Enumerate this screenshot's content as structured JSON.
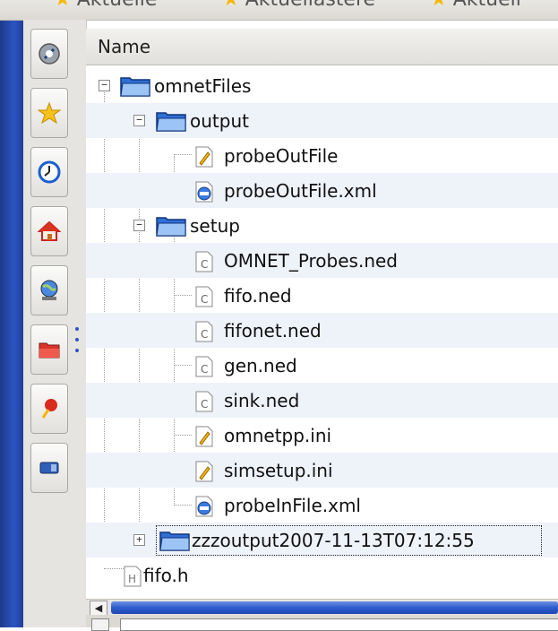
{
  "topbar": {
    "crumbs": [
      "Aktuelle",
      "Aktuellastere",
      "Aktuell"
    ]
  },
  "sidebar": {
    "items": [
      {
        "icon": "network-icon"
      },
      {
        "icon": "star-icon"
      },
      {
        "icon": "history-clock-icon"
      },
      {
        "icon": "home-icon"
      },
      {
        "icon": "network-globe-icon"
      },
      {
        "icon": "folder-icon"
      },
      {
        "icon": "pin-icon"
      },
      {
        "icon": "device-icon"
      }
    ]
  },
  "tree": {
    "column_header": "Name",
    "rows": [
      {
        "label": "omnetFiles",
        "type": "folder"
      },
      {
        "label": "output",
        "type": "folder"
      },
      {
        "label": "probeOutFile",
        "type": "text"
      },
      {
        "label": "probeOutFile.xml",
        "type": "xml"
      },
      {
        "label": "setup",
        "type": "folder"
      },
      {
        "label": "OMNET_Probes.ned",
        "type": "code"
      },
      {
        "label": "fifo.ned",
        "type": "code"
      },
      {
        "label": "fifonet.ned",
        "type": "code"
      },
      {
        "label": "gen.ned",
        "type": "code"
      },
      {
        "label": "sink.ned",
        "type": "code"
      },
      {
        "label": "omnetpp.ini",
        "type": "text"
      },
      {
        "label": "simsetup.ini",
        "type": "text"
      },
      {
        "label": "probeInFile.xml",
        "type": "xml"
      },
      {
        "label": "zzzoutput2007-11-13T07:12:55",
        "type": "folder"
      },
      {
        "label": "fifo.h",
        "type": "header"
      }
    ]
  },
  "colors": {
    "frame_blue": "#2c55c2",
    "folder_blue": "#2f6fd6",
    "row_alt": "#eef2f9"
  }
}
